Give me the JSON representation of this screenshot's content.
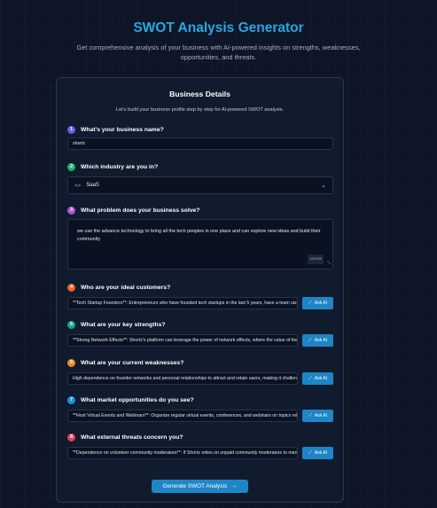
{
  "header": {
    "title": "SWOT Analysis Generator",
    "subtitle": "Get comprehensive analysis of your business with AI-powered insights on strengths, weaknesses, opportunities, and threats."
  },
  "card": {
    "title": "Business Details",
    "subtitle": "Let's build your business profile step by step for AI-powered SWOT analysis."
  },
  "questions": [
    {
      "num": "1",
      "label": "What's your business name?",
      "color": "#6c5ce7",
      "value": "shortz"
    },
    {
      "num": "2",
      "label": "Which industry are you in?",
      "color": "#20b36a",
      "value": "SaaS"
    },
    {
      "num": "3",
      "label": "What problem does your business solve?",
      "color": "#b94fd1",
      "value": "we use the advance technology to bring all the tech peoples in one place and can explore new ideas and build their community",
      "counter": "131/500"
    },
    {
      "num": "4",
      "label": "Who are your ideal customers?",
      "color": "#f0632b",
      "value": "**Tech Startup Founders**: Entrepreneurs who have founded tech startups in the last 5 years, have a team size of"
    },
    {
      "num": "5",
      "label": "What are your key strengths?",
      "color": "#14a88c",
      "value": "**Strong Network Effects**: Shortz's platform can leverage the power of network effects, where the value of the p"
    },
    {
      "num": "6",
      "label": "What are your current weaknesses?",
      "color": "#f08a1e",
      "value": "High dependence on founder networks and personal relationships to attract and retain users, making it challeng"
    },
    {
      "num": "7",
      "label": "What market opportunities do you see?",
      "color": "#1f8fd6",
      "value": "**Host Virtual Events and Webinars**: Organize regular virtual events, conferences, and webinars on topics releva"
    },
    {
      "num": "8",
      "label": "What external threats concern you?",
      "color": "#e0435e",
      "value": "**Dependence on volunteer community moderators**: If Shortz relies on unpaid community moderators to man"
    }
  ],
  "industry_code_icon": "<>",
  "chevron": "⌄",
  "ask_ai_label": "Ask AI",
  "ask_ai_icon": "⟋",
  "generate_label": "Generate SWOT Analysis",
  "generate_arrow": "→",
  "resize_glyph": "⤡"
}
